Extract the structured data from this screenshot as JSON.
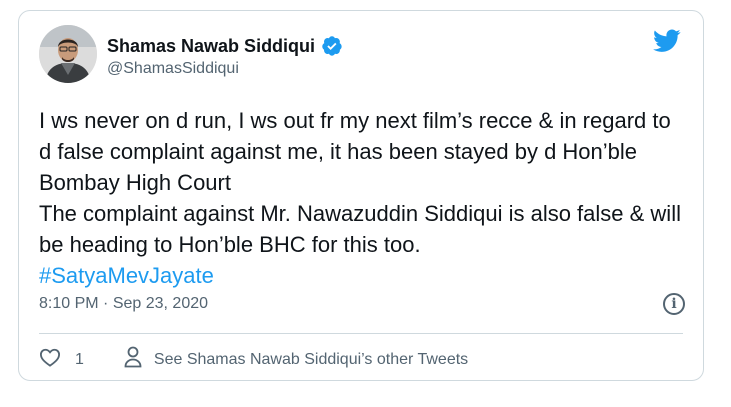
{
  "tweet": {
    "author_name": "Shamas Nawab Siddiqui",
    "handle": "@ShamasSiddiqui",
    "text": "I ws never on d run, I ws out fr my next film’s recce & in regard to d false complaint against me, it has been stayed by d Hon’ble Bombay High Court\nThe complaint against Mr. Nawazuddin Siddiqui is also false & will be heading to Hon’ble BHC for this too.",
    "hashtag": "#SatyaMevJayate",
    "time": "8:10 PM",
    "separator": "·",
    "date": "Sep 23, 2020",
    "likes": "1",
    "other_tweets_link": "See Shamas Nawab Siddiqui’s other Tweets"
  },
  "colors": {
    "accent": "#1d9bf0",
    "text": "#0f1419",
    "secondary": "#536471",
    "border": "#cfd9de"
  },
  "icons": {
    "verified": "verified-badge-icon",
    "brand": "twitter-bird-icon",
    "info": "info-icon",
    "like": "heart-icon",
    "profile": "person-icon"
  }
}
